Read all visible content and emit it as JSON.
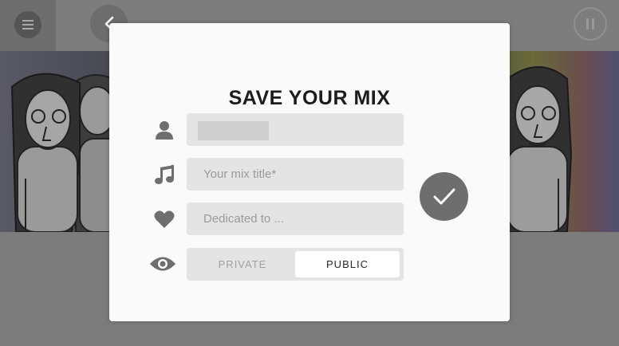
{
  "colors": {
    "accent": "#6e6e6e",
    "field_bg": "#e4e4e4",
    "modal_bg": "#fafafa"
  },
  "icons": {
    "menu": "menu-icon",
    "back": "chevron-left-icon",
    "pause": "pause-icon",
    "user": "user-icon",
    "music": "music-note-icon",
    "heart": "heart-icon",
    "eye": "eye-icon",
    "confirm": "checkmark-icon"
  },
  "dialog": {
    "title": "SAVE YOUR MIX",
    "name_field": {
      "value": ""
    },
    "title_field": {
      "placeholder": "Your mix title*"
    },
    "dedication_field": {
      "placeholder": "Dedicated to ..."
    },
    "visibility": {
      "options": [
        "PRIVATE",
        "PUBLIC"
      ],
      "selected": "PUBLIC"
    }
  }
}
